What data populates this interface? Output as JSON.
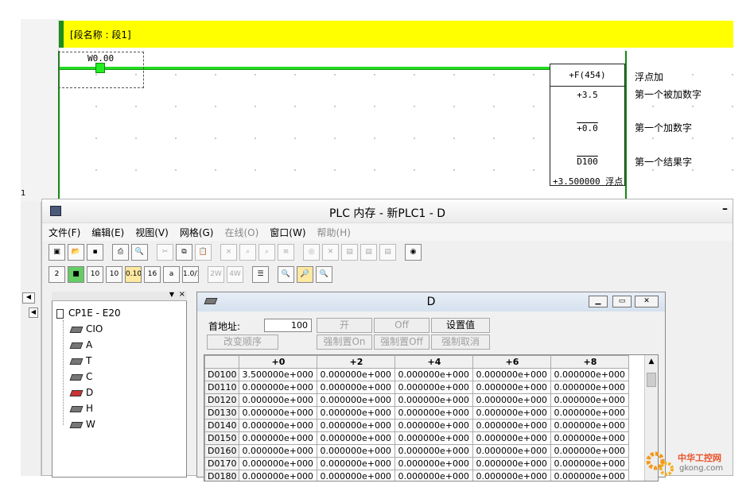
{
  "ladder": {
    "section_label": "[段名称 : 段1]",
    "contact_address": "W0.00",
    "instruction": "+F(454)",
    "operand1": "+3.5",
    "operand2": "+0.0",
    "operand3": "D100",
    "result_value": "+3.500000 浮点",
    "comments": [
      "浮点加",
      "第一个被加数字",
      "第一个加数字",
      "第一个结果字"
    ],
    "left_number": "1"
  },
  "window": {
    "title": "PLC 内存 - 新PLC1 - D",
    "min_glyph": "–",
    "menu": [
      {
        "label": "文件(F)"
      },
      {
        "label": "编辑(E)"
      },
      {
        "label": "视图(V)"
      },
      {
        "label": "网格(G)"
      },
      {
        "label": "在线(O)"
      },
      {
        "label": "窗口(W)"
      },
      {
        "label": "帮助(H)"
      }
    ],
    "toolbar2": [
      "2",
      "",
      "10",
      "10",
      "0.10",
      "16",
      "a",
      "1.0/10",
      "2W",
      "4W",
      "",
      "",
      "",
      ""
    ]
  },
  "tree": {
    "root": "CP1E - E20",
    "items": [
      "CIO",
      "A",
      "T",
      "C",
      "D",
      "H",
      "W"
    ],
    "selected": "D"
  },
  "child": {
    "title": "D",
    "start_label": "首地址:",
    "start_value": "100",
    "buttons": {
      "on": "开",
      "off": "Off",
      "set": "设置值",
      "change_order": "改变顺序",
      "force_on": "强制置On",
      "force_off": "强制置Off",
      "force_cancel": "强制取消"
    },
    "columns": [
      "",
      "+0",
      "+2",
      "+4",
      "+6",
      "+8"
    ],
    "rows": [
      [
        "D0100",
        "3.500000e+000",
        "0.000000e+000",
        "0.000000e+000",
        "0.000000e+000",
        "0.000000e+000"
      ],
      [
        "D0110",
        "0.000000e+000",
        "0.000000e+000",
        "0.000000e+000",
        "0.000000e+000",
        "0.000000e+000"
      ],
      [
        "D0120",
        "0.000000e+000",
        "0.000000e+000",
        "0.000000e+000",
        "0.000000e+000",
        "0.000000e+000"
      ],
      [
        "D0130",
        "0.000000e+000",
        "0.000000e+000",
        "0.000000e+000",
        "0.000000e+000",
        "0.000000e+000"
      ],
      [
        "D0140",
        "0.000000e+000",
        "0.000000e+000",
        "0.000000e+000",
        "0.000000e+000",
        "0.000000e+000"
      ],
      [
        "D0150",
        "0.000000e+000",
        "0.000000e+000",
        "0.000000e+000",
        "0.000000e+000",
        "0.000000e+000"
      ],
      [
        "D0160",
        "0.000000e+000",
        "0.000000e+000",
        "0.000000e+000",
        "0.000000e+000",
        "0.000000e+000"
      ],
      [
        "D0170",
        "0.000000e+000",
        "0.000000e+000",
        "0.000000e+000",
        "0.000000e+000",
        "0.000000e+000"
      ],
      [
        "D0180",
        "0.000000e+000",
        "0.000000e+000",
        "0.000000e+000",
        "0.000000e+000",
        "0.000000e+000"
      ]
    ]
  },
  "watermark": {
    "name": "中华工控网",
    "url": "gkong.com"
  }
}
